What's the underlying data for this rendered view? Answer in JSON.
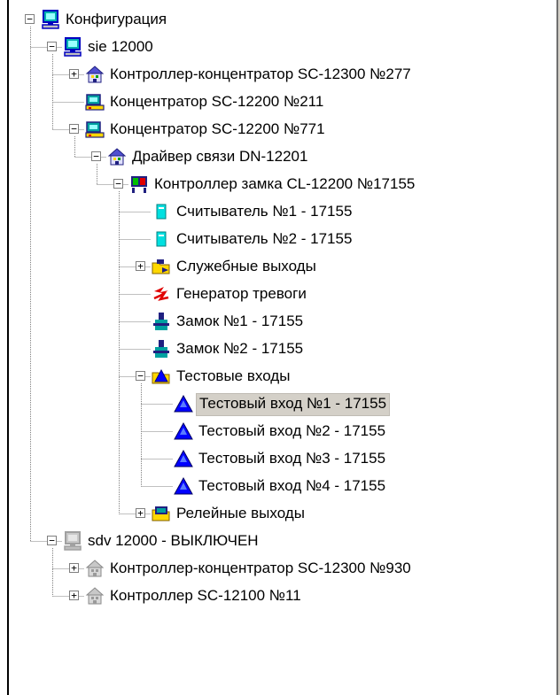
{
  "tree": {
    "nodes": [
      {
        "id": "n0",
        "depth": 0,
        "parent": null,
        "label": "Конфигурация",
        "icon": "computer-icon",
        "toggle": "-",
        "selected": false
      },
      {
        "id": "n1",
        "depth": 1,
        "parent": "n0",
        "label": "sie 12000",
        "icon": "computer-icon",
        "toggle": "-",
        "selected": false
      },
      {
        "id": "n2",
        "depth": 2,
        "parent": "n1",
        "label": "Контроллер-концентратор SC-12300 №277",
        "icon": "controller-concentrator-icon",
        "toggle": "+",
        "selected": false
      },
      {
        "id": "n3",
        "depth": 2,
        "parent": "n1",
        "label": "Концентратор SC-12200 №211",
        "icon": "concentrator-icon",
        "toggle": "",
        "selected": false
      },
      {
        "id": "n4",
        "depth": 2,
        "parent": "n1",
        "label": "Концентратор SC-12200 №771",
        "icon": "concentrator-icon",
        "toggle": "-",
        "selected": false
      },
      {
        "id": "n5",
        "depth": 3,
        "parent": "n4",
        "label": "Драйвер связи DN-12201",
        "icon": "driver-icon",
        "toggle": "-",
        "selected": false
      },
      {
        "id": "n6",
        "depth": 4,
        "parent": "n5",
        "label": "Контроллер замка CL-12200 №17155",
        "icon": "lock-controller-icon",
        "toggle": "-",
        "selected": false
      },
      {
        "id": "n7",
        "depth": 5,
        "parent": "n6",
        "label": "Считыватель №1 - 17155",
        "icon": "card-reader-icon",
        "toggle": "",
        "selected": false
      },
      {
        "id": "n8",
        "depth": 5,
        "parent": "n6",
        "label": "Считыватель №2 - 17155",
        "icon": "card-reader-icon",
        "toggle": "",
        "selected": false
      },
      {
        "id": "n9",
        "depth": 5,
        "parent": "n6",
        "label": "Служебные выходы",
        "icon": "service-outputs-icon",
        "toggle": "+",
        "selected": false
      },
      {
        "id": "n10",
        "depth": 5,
        "parent": "n6",
        "label": "Генератор тревоги",
        "icon": "alarm-generator-icon",
        "toggle": "",
        "selected": false
      },
      {
        "id": "n11",
        "depth": 5,
        "parent": "n6",
        "label": "Замок №1 - 17155",
        "icon": "lock-icon",
        "toggle": "",
        "selected": false
      },
      {
        "id": "n12",
        "depth": 5,
        "parent": "n6",
        "label": "Замок №2 - 17155",
        "icon": "lock-icon",
        "toggle": "",
        "selected": false
      },
      {
        "id": "n13",
        "depth": 5,
        "parent": "n6",
        "label": "Тестовые входы",
        "icon": "test-inputs-folder-icon",
        "toggle": "-",
        "selected": false
      },
      {
        "id": "n14",
        "depth": 6,
        "parent": "n13",
        "label": "Тестовый вход №1 - 17155",
        "icon": "test-input-icon",
        "toggle": "",
        "selected": true
      },
      {
        "id": "n15",
        "depth": 6,
        "parent": "n13",
        "label": "Тестовый вход №2 - 17155",
        "icon": "test-input-icon",
        "toggle": "",
        "selected": false
      },
      {
        "id": "n16",
        "depth": 6,
        "parent": "n13",
        "label": "Тестовый вход №3 - 17155",
        "icon": "test-input-icon",
        "toggle": "",
        "selected": false
      },
      {
        "id": "n17",
        "depth": 6,
        "parent": "n13",
        "label": "Тестовый вход №4 - 17155",
        "icon": "test-input-icon",
        "toggle": "",
        "selected": false
      },
      {
        "id": "n18",
        "depth": 5,
        "parent": "n6",
        "label": "Релейные выходы",
        "icon": "relay-outputs-icon",
        "toggle": "+",
        "selected": false
      },
      {
        "id": "n19",
        "depth": 1,
        "parent": "n0",
        "label": "sdv 12000 - ВЫКЛЮЧЕН",
        "icon": "computer-off-icon",
        "toggle": "-",
        "selected": false
      },
      {
        "id": "n20",
        "depth": 2,
        "parent": "n19",
        "label": "Контроллер-концентратор SC-12300 №930",
        "icon": "controller-concentrator-off-icon",
        "toggle": "+",
        "selected": false
      },
      {
        "id": "n21",
        "depth": 2,
        "parent": "n19",
        "label": "Контроллер SC-12100 №11",
        "icon": "controller-off-icon",
        "toggle": "+",
        "selected": false
      }
    ]
  },
  "colors": {
    "selection_bg": "#d4d0c8",
    "tree_line": "#808080",
    "computer_blue": "#0000c0",
    "screen_teal": "#00b0b0",
    "test_input_blue": "#0000ff",
    "alarm_red": "#e00000",
    "folder_yellow": "#ffd800",
    "disabled_gray": "#a0a0a0"
  }
}
